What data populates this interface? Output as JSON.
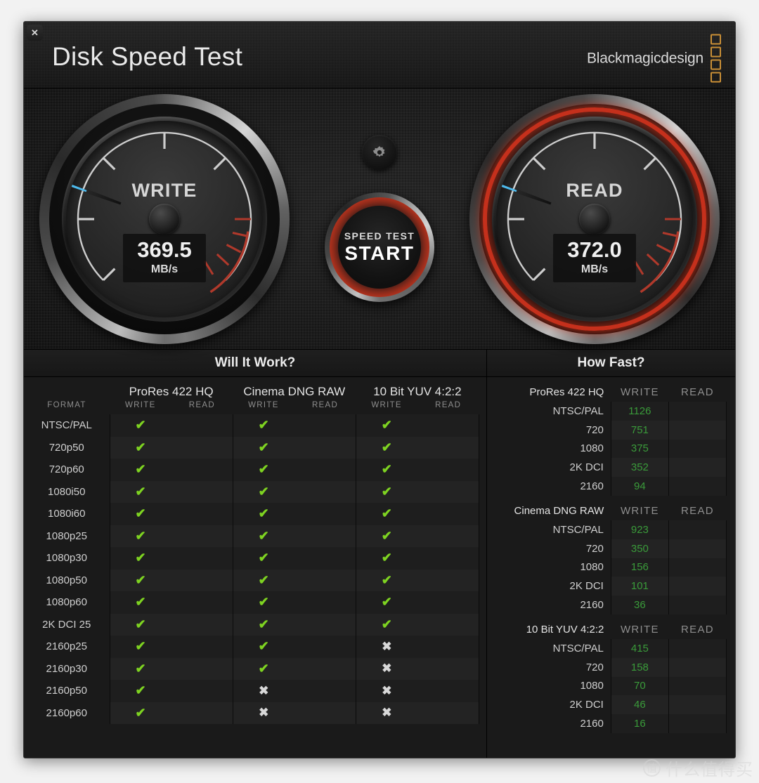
{
  "window": {
    "close_label": "✕",
    "title": "Disk Speed Test",
    "brand": "Blackmagicdesign"
  },
  "gauges": {
    "write": {
      "label": "WRITE",
      "value": "369.5",
      "unit": "MB/s",
      "needle_deg": 200,
      "active": false
    },
    "read": {
      "label": "READ",
      "value": "372.0",
      "unit": "MB/s",
      "needle_deg": 200,
      "active": true
    }
  },
  "center": {
    "gear_icon": "gear-icon",
    "start_line1": "SPEED TEST",
    "start_line2": "START"
  },
  "will_it_work": {
    "title": "Will It Work?",
    "format_label": "FORMAT",
    "groups": [
      "ProRes 422 HQ",
      "Cinema DNG RAW",
      "10 Bit YUV 4:2:2"
    ],
    "sub_headers": [
      "WRITE",
      "READ"
    ],
    "rows": [
      {
        "format": "NTSC/PAL",
        "cells": [
          "ok",
          "",
          "ok",
          "",
          "ok",
          ""
        ]
      },
      {
        "format": "720p50",
        "cells": [
          "ok",
          "",
          "ok",
          "",
          "ok",
          ""
        ]
      },
      {
        "format": "720p60",
        "cells": [
          "ok",
          "",
          "ok",
          "",
          "ok",
          ""
        ]
      },
      {
        "format": "1080i50",
        "cells": [
          "ok",
          "",
          "ok",
          "",
          "ok",
          ""
        ]
      },
      {
        "format": "1080i60",
        "cells": [
          "ok",
          "",
          "ok",
          "",
          "ok",
          ""
        ]
      },
      {
        "format": "1080p25",
        "cells": [
          "ok",
          "",
          "ok",
          "",
          "ok",
          ""
        ]
      },
      {
        "format": "1080p30",
        "cells": [
          "ok",
          "",
          "ok",
          "",
          "ok",
          ""
        ]
      },
      {
        "format": "1080p50",
        "cells": [
          "ok",
          "",
          "ok",
          "",
          "ok",
          ""
        ]
      },
      {
        "format": "1080p60",
        "cells": [
          "ok",
          "",
          "ok",
          "",
          "ok",
          ""
        ]
      },
      {
        "format": "2K DCI 25",
        "cells": [
          "ok",
          "",
          "ok",
          "",
          "ok",
          ""
        ]
      },
      {
        "format": "2160p25",
        "cells": [
          "ok",
          "",
          "ok",
          "",
          "no",
          ""
        ]
      },
      {
        "format": "2160p30",
        "cells": [
          "ok",
          "",
          "ok",
          "",
          "no",
          ""
        ]
      },
      {
        "format": "2160p50",
        "cells": [
          "ok",
          "",
          "no",
          "",
          "no",
          ""
        ]
      },
      {
        "format": "2160p60",
        "cells": [
          "ok",
          "",
          "no",
          "",
          "no",
          ""
        ]
      }
    ],
    "ok_glyph": "✔",
    "no_glyph": "✖"
  },
  "how_fast": {
    "title": "How Fast?",
    "write_label": "WRITE",
    "read_label": "READ",
    "groups": [
      {
        "name": "ProRes 422 HQ",
        "rows": [
          {
            "res": "NTSC/PAL",
            "write": "1126",
            "read": ""
          },
          {
            "res": "720",
            "write": "751",
            "read": ""
          },
          {
            "res": "1080",
            "write": "375",
            "read": ""
          },
          {
            "res": "2K DCI",
            "write": "352",
            "read": ""
          },
          {
            "res": "2160",
            "write": "94",
            "read": ""
          }
        ]
      },
      {
        "name": "Cinema DNG RAW",
        "rows": [
          {
            "res": "NTSC/PAL",
            "write": "923",
            "read": ""
          },
          {
            "res": "720",
            "write": "350",
            "read": ""
          },
          {
            "res": "1080",
            "write": "156",
            "read": ""
          },
          {
            "res": "2K DCI",
            "write": "101",
            "read": ""
          },
          {
            "res": "2160",
            "write": "36",
            "read": ""
          }
        ]
      },
      {
        "name": "10 Bit YUV 4:2:2",
        "rows": [
          {
            "res": "NTSC/PAL",
            "write": "415",
            "read": ""
          },
          {
            "res": "720",
            "write": "158",
            "read": ""
          },
          {
            "res": "1080",
            "write": "70",
            "read": ""
          },
          {
            "res": "2K DCI",
            "write": "46",
            "read": ""
          },
          {
            "res": "2160",
            "write": "16",
            "read": ""
          }
        ]
      }
    ]
  },
  "watermark": {
    "logo": "值",
    "text": "什么值得买"
  },
  "colors": {
    "accent_orange": "#c98f36",
    "needle_blue": "#4fbcee",
    "ok_green": "#7ed321",
    "value_green": "#3a9b3a",
    "redzone": "#c0392b",
    "active_ring": "#c5301c"
  }
}
